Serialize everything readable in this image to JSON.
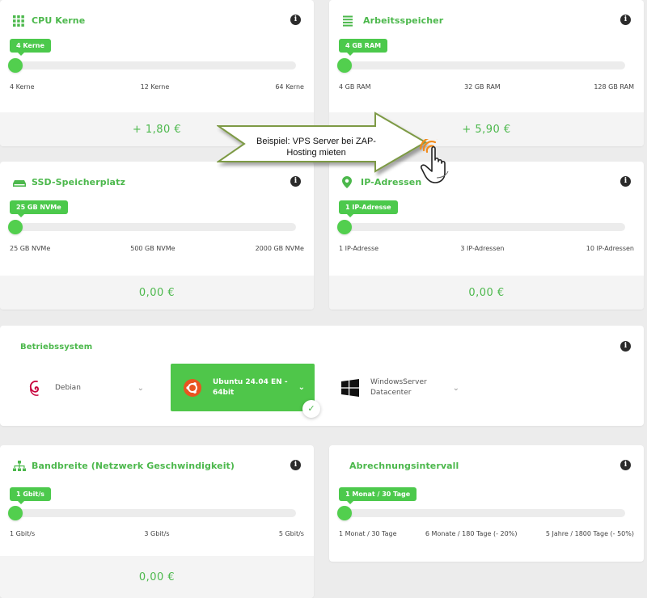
{
  "cards": {
    "cpu": {
      "title": "CPU Kerne",
      "badge": "4 Kerne",
      "ticks": [
        "4 Kerne",
        "12 Kerne",
        "64 Kerne"
      ],
      "price": "+ 1,80 €",
      "slider_value_fraction": 0
    },
    "ram": {
      "title": "Arbeitsspeicher",
      "badge": "4 GB RAM",
      "ticks": [
        "4 GB RAM",
        "32 GB RAM",
        "128 GB RAM"
      ],
      "price": "+ 5,90 €",
      "slider_value_fraction": 0
    },
    "ssd": {
      "title": "SSD-Speicherplatz",
      "badge": "25 GB NVMe",
      "ticks": [
        "25 GB NVMe",
        "500 GB NVMe",
        "2000 GB NVMe"
      ],
      "price": "0,00 €",
      "slider_value_fraction": 0
    },
    "ip": {
      "title": "IP-Adressen",
      "badge": "1 IP-Adresse",
      "ticks": [
        "1 IP-Adresse",
        "3 IP-Adressen",
        "10 IP-Adressen"
      ],
      "price": "0,00 €",
      "slider_value_fraction": 0
    },
    "bandwidth": {
      "title": "Bandbreite (Netzwerk Geschwindigkeit)",
      "badge": "1 Gbit/s",
      "ticks": [
        "1 Gbit/s",
        "3 Gbit/s",
        "5 Gbit/s"
      ],
      "price": "0,00 €",
      "slider_value_fraction": 0
    },
    "billing": {
      "title": "Abrechnungsintervall",
      "badge": "1 Monat / 30 Tage",
      "ticks": [
        "1 Monat / 30 Tage",
        "6 Monate / 180 Tage (- 20%)",
        "5 Jahre / 1800 Tage (- 50%)"
      ],
      "slider_value_fraction": 0
    }
  },
  "os": {
    "title": "Betriebssystem",
    "options": [
      {
        "label": "Debian",
        "icon": "debian-icon",
        "selected": false
      },
      {
        "label": "Ubuntu 24.04 EN - 64bit",
        "icon": "ubuntu-icon",
        "selected": true
      },
      {
        "label": "WindowsServer Datacenter",
        "icon": "windows-icon",
        "selected": false
      }
    ]
  },
  "overlay": {
    "text": "Beispiel: VPS Server bei ZAP-Hosting mieten"
  },
  "colors": {
    "accent": "#4cb84c",
    "slider": "#52cf4e",
    "track": "#ececec",
    "page_bg": "#ececec",
    "price_bg": "#f4f4f4"
  }
}
